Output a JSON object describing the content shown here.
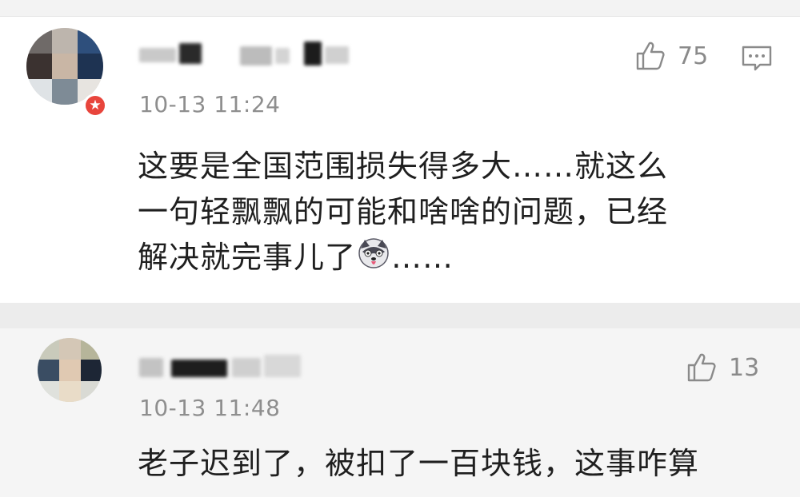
{
  "comments": [
    {
      "timestamp": "10-13 11:24",
      "likes": "75",
      "text_lines": [
        "这要是全国范围损失得多大……就这么",
        "一句轻飘飘的可能和啥啥的问题，已经",
        "解决就完事儿了"
      ],
      "text_suffix": "……",
      "emoji": "husky-emoji",
      "badge_icon": "star-icon"
    },
    {
      "timestamp": "10-13 11:48",
      "likes": "13",
      "text_lines": [
        "老子迟到了，被扣了一百块钱，这事咋算"
      ]
    }
  ],
  "colors": {
    "text": "#1f1f1f",
    "meta": "#8e8e8e",
    "badge": "#e8453c",
    "card_bg": "#ffffff",
    "separator": "#ececec"
  }
}
